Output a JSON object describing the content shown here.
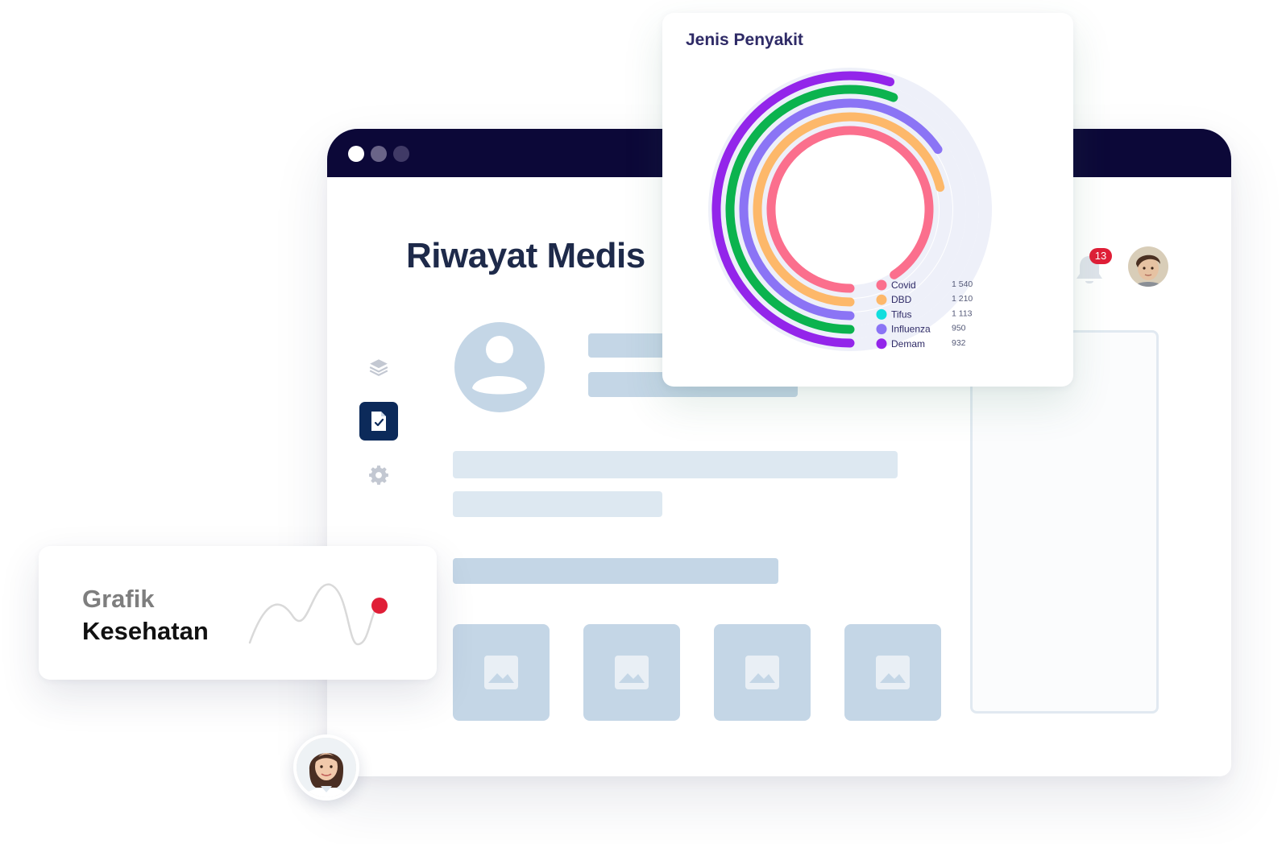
{
  "app_window": {
    "title": "Riwayat Medis",
    "notification_count": "13"
  },
  "chart_card": {
    "title": "Jenis Penyakit"
  },
  "chart_data": {
    "type": "radial-bar",
    "title": "Jenis Penyakit",
    "categories": [
      "Covid",
      "DBD",
      "Tifus",
      "Influenza",
      "Demam"
    ],
    "values": [
      1540,
      1210,
      1113,
      950,
      932
    ],
    "value_labels": [
      "1 540",
      "1 210",
      "1 113",
      "950",
      "932"
    ],
    "colors": [
      "#fb6f8d",
      "#fdb86a",
      "#8b74f5",
      "#0bb34e",
      "#9325ea"
    ],
    "legend_colors": [
      "#fb6f8d",
      "#fdb86a",
      "#11dede",
      "#8b74f5",
      "#9325ea"
    ],
    "legend_position": "bottom-right"
  },
  "grafik_card": {
    "line1": "Grafik",
    "line2": "Kesehatan"
  },
  "icons": {
    "sidebar": [
      "layers-icon",
      "document-check-icon",
      "gear-icon"
    ],
    "header": [
      "bell-icon"
    ],
    "placeholders": [
      "image-icon"
    ]
  },
  "colors": {
    "titlebar": "#0c0838",
    "accent_nav": "#0c2a5a",
    "badge": "#e01e37",
    "placeholder": "#c4d6e6",
    "grafik_dot": "#e01e37"
  }
}
